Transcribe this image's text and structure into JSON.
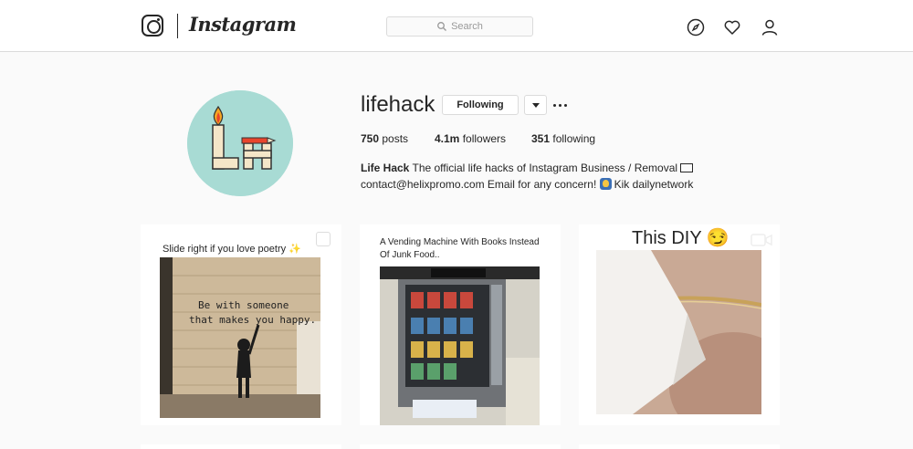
{
  "nav": {
    "wordmark": "Instagram",
    "search_placeholder": "Search",
    "icons": [
      "instagram-logo-icon",
      "compass-icon",
      "heart-icon",
      "person-icon"
    ]
  },
  "profile": {
    "username": "lifehack",
    "following_button": "Following",
    "avatar_initials": "LH",
    "stats": {
      "posts_count": "750",
      "posts_label": "posts",
      "followers_count": "4.1m",
      "followers_label": "followers",
      "following_count": "351",
      "following_label": "following"
    },
    "bio": {
      "name": "Life Hack",
      "line1_rest": "The official life hacks of Instagram Business / Removal",
      "line2_a": "contact@helixpromo.com Email for any concern!",
      "line2_b": "Kik dailynetwork"
    }
  },
  "posts": [
    {
      "caption": "Slide right if you love poetry ✨",
      "wall_text_1": "Be with someone",
      "wall_text_2": "that makes you happy.",
      "type": "carousel"
    },
    {
      "caption_1": "A Vending Machine With Books Instead",
      "caption_2": "Of Junk Food..",
      "type": "image"
    },
    {
      "caption": "This DIY 😏",
      "type": "video"
    }
  ],
  "colors": {
    "accent_blue": "#3897f0",
    "avatar_bg": "#a8dbd4",
    "border": "#dbdbdb"
  }
}
